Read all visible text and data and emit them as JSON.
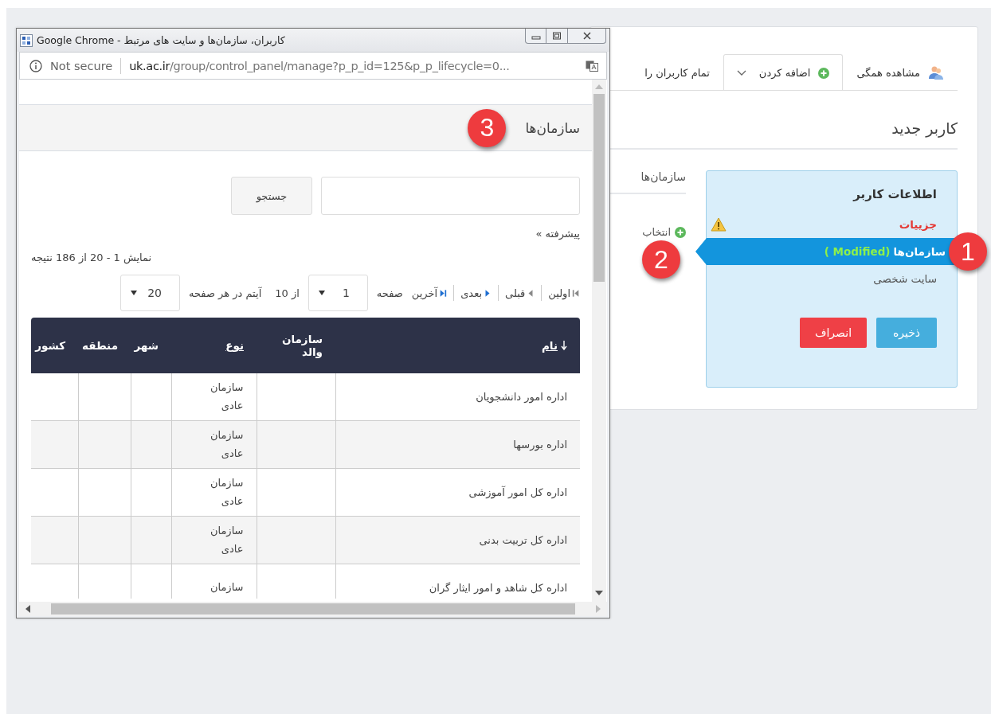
{
  "background_page": {
    "tabs": [
      {
        "label": "مشاهده همگی",
        "kind": "users",
        "selected": false,
        "dropdown": false
      },
      {
        "label": "اضافه کردن",
        "kind": "add",
        "selected": true,
        "dropdown": true
      },
      {
        "label": "تمام کاربران را",
        "kind": "plain",
        "selected": false,
        "dropdown": false
      }
    ],
    "title": "کاربر جدید",
    "user_info": {
      "heading": "اطلاعات کاربر",
      "items": [
        {
          "label": "جزییات",
          "error": true,
          "selected": false
        },
        {
          "label": "سازمان‌ها",
          "note": "( Modified)",
          "error": false,
          "selected": true,
          "badge": "1"
        },
        {
          "label": "سایت شخصی",
          "error": false,
          "selected": false
        }
      ],
      "buttons": [
        {
          "label": "ذخیره",
          "kind": "primary"
        },
        {
          "label": "انصراف",
          "kind": "danger"
        }
      ]
    },
    "organizations": {
      "heading": "سازمان‌ها",
      "select_label": "انتخاب",
      "badge": "2"
    }
  },
  "popup": {
    "window_title": "کاربران، سازمان‌ها و سایت های مرتبط - Google Chrome",
    "security": "Not secure",
    "url_host": "uk.ac.ir",
    "url_path": "/group/control_panel/manage?p_p_id=125&p_p_lifecycle=0...",
    "header": {
      "title": "سازمان‌ها",
      "badge": "3"
    },
    "search": {
      "button": "جستجو"
    },
    "advanced_link": "پیشرفته »",
    "results": "نمایش 1 - 20 از 186 نتیجه",
    "pagination": {
      "links": [
        {
          "label": "اولین",
          "kind": "first"
        },
        {
          "label": "قبلی",
          "kind": "prev"
        },
        {
          "label": "بعدی",
          "kind": "next"
        },
        {
          "label": "آخرین",
          "kind": "last"
        }
      ],
      "page_label": "صفحه",
      "page": "1",
      "page_count": "از 10",
      "per_page_label": "آیتم در هر صفحه",
      "per_page": "20"
    },
    "table": {
      "columns": [
        {
          "label": "نام",
          "sortable": true,
          "sorted": true
        },
        {
          "label": "سازمان والد",
          "sortable": false,
          "sorted": false
        },
        {
          "label": "نوع",
          "sortable": true,
          "sorted": false
        },
        {
          "label": "شهر",
          "sortable": false,
          "sorted": false
        },
        {
          "label": "منطقه",
          "sortable": false,
          "sorted": false
        },
        {
          "label": "کشور",
          "sortable": false,
          "sorted": false
        }
      ],
      "rows": [
        {
          "name": "اداره امور دانشجویان",
          "type": "سازمان عادی"
        },
        {
          "name": "اداره بورسها",
          "type": "سازمان عادی"
        },
        {
          "name": "اداره کل امور آموزشی",
          "type": "سازمان عادی"
        },
        {
          "name": "اداره کل تربیت بدنی",
          "type": "سازمان عادی"
        },
        {
          "name": "اداره کل شاهد و امور ایثار گران",
          "type": "سازمان"
        }
      ]
    }
  }
}
